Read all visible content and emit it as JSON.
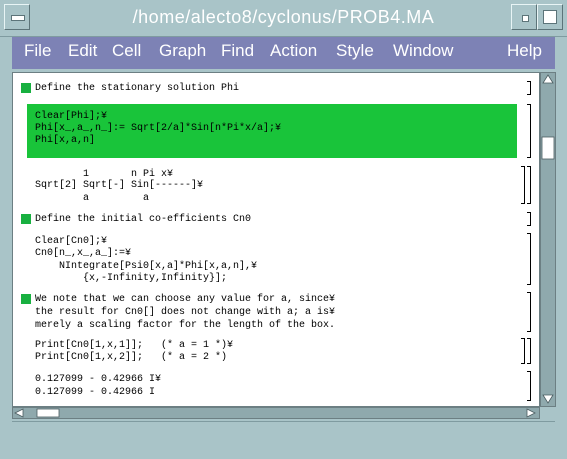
{
  "window": {
    "title": "/home/alecto8/cyclonus/PROB4.MA"
  },
  "menu": {
    "items": [
      {
        "id": "file",
        "label": "File"
      },
      {
        "id": "edit",
        "label": "Edit"
      },
      {
        "id": "cell",
        "label": "Cell"
      },
      {
        "id": "graph",
        "label": "Graph"
      },
      {
        "id": "find",
        "label": "Find"
      },
      {
        "id": "action",
        "label": "Action"
      },
      {
        "id": "style",
        "label": "Style"
      },
      {
        "id": "window",
        "label": "Window"
      },
      {
        "id": "help",
        "label": "Help"
      }
    ]
  },
  "notebook": {
    "section1_title": "Define the stationary solution Phi",
    "input1": [
      "Clear[Phi];¥",
      "Phi[x_,a_,n_]:= Sqrt[2/a]*Sin[n*Pi*x/a];¥",
      "Phi[x,a,n]"
    ],
    "output1": [
      "        1       n Pi x¥",
      "Sqrt[2] Sqrt[-] Sin[------]¥",
      "        a         a"
    ],
    "section2_title": "Define the initial co-efficients Cn0",
    "input2": [
      "Clear[Cn0];¥",
      "Cn0[n_,x_,a_]:=¥",
      "    NIntegrate[Psi0[x,a]*Phi[x,a,n],¥",
      "        {x,-Infinity,Infinity}];"
    ],
    "note3": [
      "We note that we can choose any value for a, since¥",
      "the result for Cn0[] does not change with a; a is¥",
      "merely a scaling factor for the length of the box."
    ],
    "input4": [
      "Print[Cn0[1,x,1]];   (* a = 1 *)¥",
      "Print[Cn0[1,x,2]];   (* a = 2 *)"
    ],
    "output4": [
      "0.127099 - 0.42966 I¥",
      "0.127099 - 0.42966 I"
    ]
  },
  "colors": {
    "window_bg": "#a9c4c8",
    "menubar_bg": "#7d82b5",
    "input_cell_bg": "#19c43a",
    "cell_marker": "#18b040"
  },
  "icons": {
    "title_left": "window-menu-icon",
    "title_min": "minimize-icon",
    "title_max": "maximize-icon",
    "scroll_up": "arrow-up-icon",
    "scroll_down": "arrow-down-icon",
    "scroll_left": "arrow-left-icon",
    "scroll_right": "arrow-right-icon"
  }
}
